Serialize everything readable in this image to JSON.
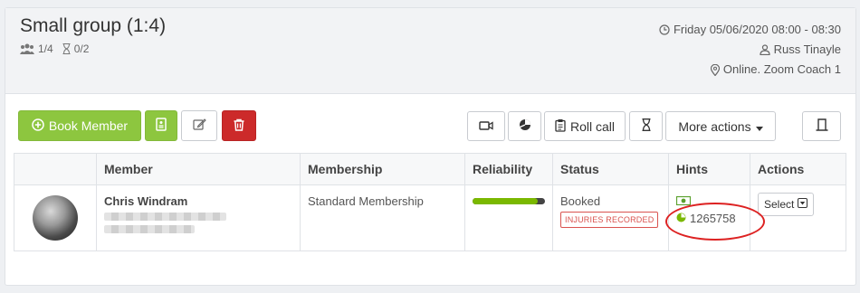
{
  "header": {
    "title": "Small group (1:4)",
    "attendees_count": "1/4",
    "waitlist_count": "0/2",
    "datetime": "Friday 05/06/2020 08:00 - 08:30",
    "coach": "Russ Tinayle",
    "location": "Online. Zoom Coach 1"
  },
  "toolbar": {
    "book_member_label": "Book Member",
    "roll_call_label": "Roll call",
    "more_actions_label": "More actions"
  },
  "table": {
    "headers": [
      "",
      "Member",
      "Membership",
      "Reliability",
      "Status",
      "Hints",
      "Actions"
    ],
    "rows": [
      {
        "member_name": "Chris Windram",
        "membership": "Standard Membership",
        "reliability": 0.9,
        "status": "Booked",
        "status_badge": "INJURIES RECORDED",
        "hint_number": "1265758",
        "action_label": "Select"
      }
    ]
  },
  "colors": {
    "green": "#8dc63f",
    "red": "#cc2a2a",
    "highlight": "#dd2222"
  }
}
